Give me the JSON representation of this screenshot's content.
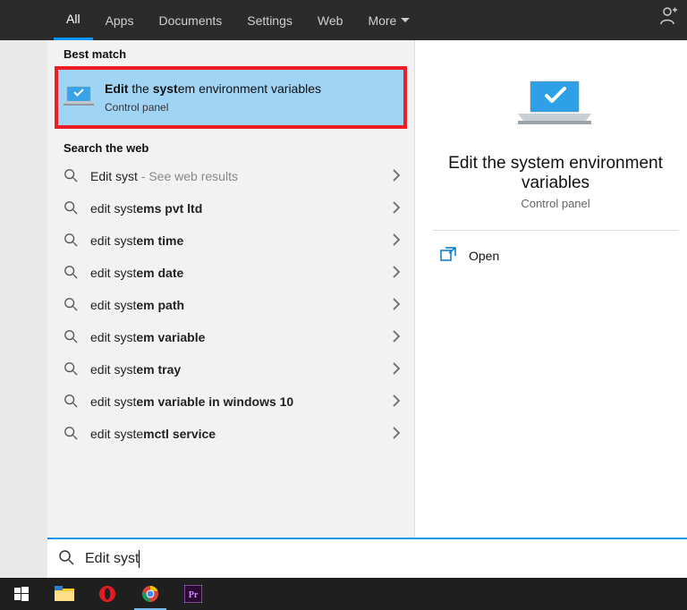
{
  "tabs": {
    "all": "All",
    "apps": "Apps",
    "documents": "Documents",
    "settings": "Settings",
    "web": "Web",
    "more": "More"
  },
  "sections": {
    "best_match": "Best match",
    "search_web": "Search the web"
  },
  "best_match": {
    "title_prefix_bold": "Edit",
    "title_mid": " the ",
    "title_mid_bold": "syst",
    "title_rest": "em environment variables",
    "subtitle": "Control panel"
  },
  "web_results": [
    {
      "pre": "Edit syst",
      "post": "",
      "hint": " - See web results"
    },
    {
      "pre": "edit syst",
      "post": "ems pvt ltd",
      "hint": ""
    },
    {
      "pre": "edit syst",
      "post": "em time",
      "hint": ""
    },
    {
      "pre": "edit syst",
      "post": "em date",
      "hint": ""
    },
    {
      "pre": "edit syst",
      "post": "em path",
      "hint": ""
    },
    {
      "pre": "edit syst",
      "post": "em variable",
      "hint": ""
    },
    {
      "pre": "edit syst",
      "post": "em tray",
      "hint": ""
    },
    {
      "pre": "edit syst",
      "post": "em variable in windows 10",
      "hint": ""
    },
    {
      "pre": "edit syste",
      "post": "mctl service",
      "hint": ""
    }
  ],
  "detail": {
    "title": "Edit the system environment variables",
    "subtitle": "Control panel",
    "open": "Open"
  },
  "search": {
    "value": "Edit syst"
  }
}
